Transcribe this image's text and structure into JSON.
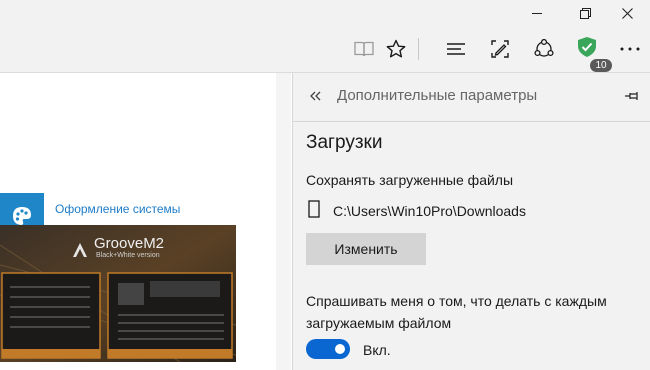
{
  "window": {
    "minimize_icon": "minimize-icon",
    "restore_icon": "restore-icon",
    "close_icon": "close-icon"
  },
  "toolbar": {
    "reading_view_icon": "book-icon",
    "favorite_icon": "star-icon",
    "hub_icon": "hub-lines-icon",
    "web_note_icon": "pen-square-icon",
    "share_icon": "share-icon",
    "extension_badge": "10",
    "extension_color": "#3aa65a",
    "more_icon": "ellipsis-icon"
  },
  "page": {
    "tile_label": "Оформление системы",
    "tile_color": "#1f87c8",
    "screenshot": {
      "app_title": "GrooveM2",
      "app_subtitle": "Black+White version"
    }
  },
  "panel": {
    "back_icon": "double-chevron-left-icon",
    "header_title": "Дополнительные параметры",
    "pin_icon": "pin-icon",
    "section_title": "Загрузки",
    "save_label": "Сохранять загруженные файлы",
    "path_value": "C:\\Users\\Win10Pro\\Downloads",
    "change_button": "Изменить",
    "ask_label": "Спрашивать меня о том, что делать с каждым загружаемым файлом",
    "toggle_state": "Вкл.",
    "toggle_on": true,
    "toggle_color": "#0a66d0"
  }
}
